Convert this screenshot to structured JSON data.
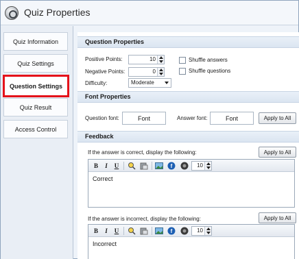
{
  "window": {
    "title": "Quiz Properties"
  },
  "sidebar": {
    "items": [
      {
        "label": "Quiz Information",
        "selected": false
      },
      {
        "label": "Quiz Settings",
        "selected": false
      },
      {
        "label": "Question Settings",
        "selected": true
      },
      {
        "label": "Quiz Result",
        "selected": false
      },
      {
        "label": "Access Control",
        "selected": false
      }
    ]
  },
  "question_properties": {
    "header": "Question Properties",
    "positive_points_label": "Positive Points:",
    "positive_points_value": "10",
    "negative_points_label": "Negative Points:",
    "negative_points_value": "0",
    "difficulty_label": "Difficulty:",
    "difficulty_value": "Moderate",
    "shuffle_answers_label": "Shuffle answers",
    "shuffle_answers_checked": false,
    "shuffle_questions_label": "Shuffle questions",
    "shuffle_questions_checked": false
  },
  "font_properties": {
    "header": "Font Properties",
    "question_font_label": "Question font:",
    "question_font_button": "Font",
    "answer_font_label": "Answer font:",
    "answer_font_button": "Font",
    "apply_all_label": "Apply to All"
  },
  "feedback": {
    "header": "Feedback",
    "correct_label": "If the answer is correct,  display the following:",
    "correct_apply_label": "Apply to All",
    "correct_text": "Correct",
    "correct_font_size": "10",
    "incorrect_label": "If the answer is incorrect,  display the following:",
    "incorrect_apply_label": "Apply to All",
    "incorrect_text": "Incorrect",
    "incorrect_font_size": "10",
    "toolbar": {
      "bold": "B",
      "italic": "I",
      "underline": "U",
      "icons": [
        "find-replace-icon",
        "paste-icon",
        "image-icon",
        "flash-icon",
        "sound-icon"
      ]
    }
  },
  "colors": {
    "selected_border": "#e5121a",
    "header_bg": "#dbe5f1",
    "sidebar_bg": "#e9eef5"
  }
}
